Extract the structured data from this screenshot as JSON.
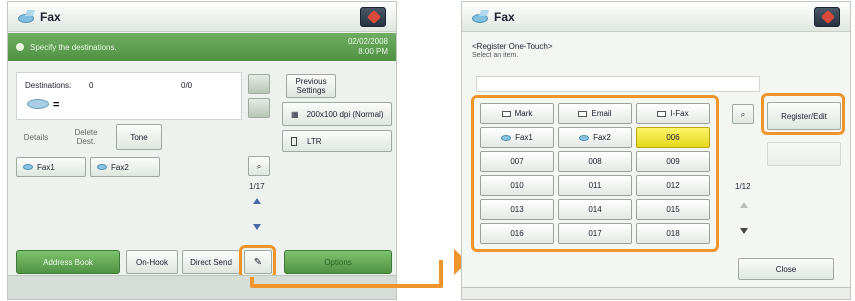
{
  "left": {
    "title": "Fax",
    "status_message": "Specify the destinations.",
    "date": "02/02/2008",
    "time": "8:00 PM",
    "destinations_label": "Destinations:",
    "destinations_count": "0",
    "destinations_ratio": "0/0",
    "tabs": {
      "details": "Details",
      "delete_dest": "Delete Dest.",
      "tone": "Tone"
    },
    "one_touch": [
      "Fax1",
      "Fax2"
    ],
    "previous_settings": "Previous Settings",
    "resolution": "200x100 dpi (Normal)",
    "paper": "LTR",
    "page_indicator": "1/17",
    "address_book": "Address Book",
    "on_hook": "On-Hook",
    "direct_send": "Direct Send",
    "options": "Options"
  },
  "right": {
    "title": "Fax",
    "heading": "<Register One-Touch>",
    "subheading": "Select an item.",
    "groups": [
      "Mark",
      "Email",
      "I-Fax"
    ],
    "cells": [
      [
        "Fax1",
        "Fax2",
        "006"
      ],
      [
        "007",
        "008",
        "009"
      ],
      [
        "010",
        "011",
        "012"
      ],
      [
        "013",
        "014",
        "015"
      ],
      [
        "016",
        "017",
        "018"
      ]
    ],
    "register_edit": "Register/Edit",
    "page_indicator": "1/12",
    "close": "Close"
  },
  "colors": {
    "highlight": "#f0952c",
    "accent_green": "#4f9142",
    "selected": "#e6d81c"
  }
}
